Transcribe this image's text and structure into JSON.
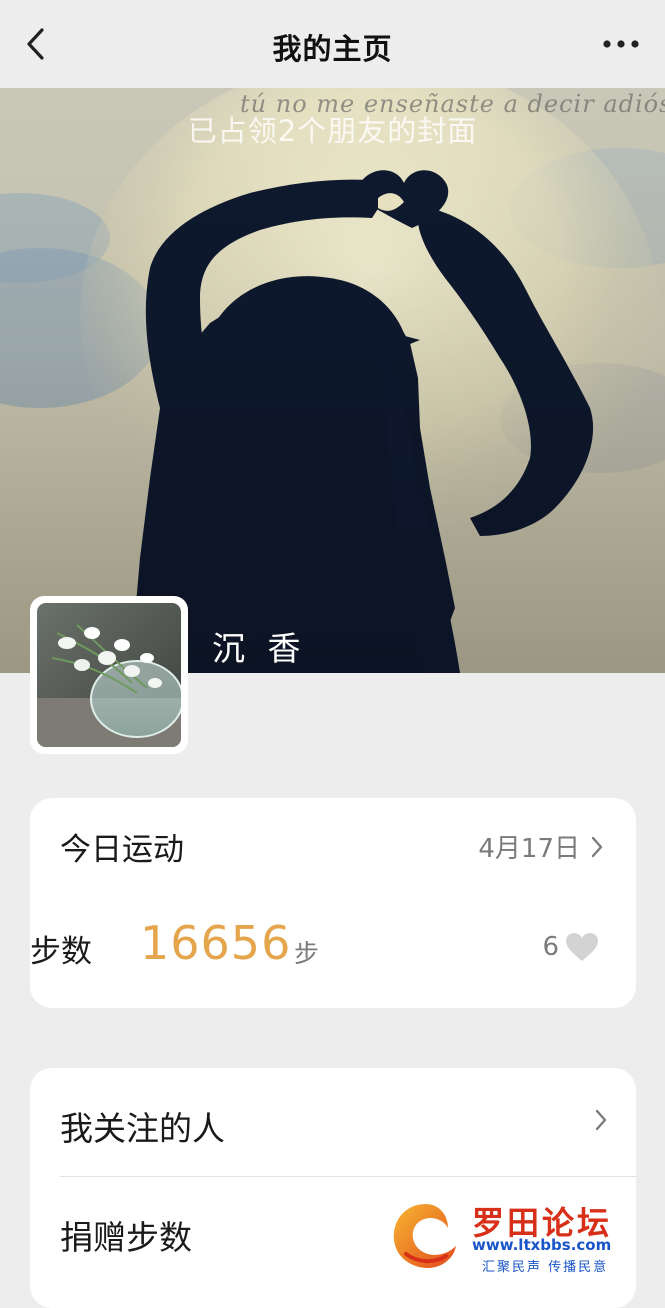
{
  "header": {
    "title": "我的主页"
  },
  "cover": {
    "caption": "已占领2个朋友的封面",
    "script_text": "tú no me enseñaste a decir adiós"
  },
  "profile": {
    "nickname": "沉 香"
  },
  "today_sport": {
    "title": "今日运动",
    "date": "4月17日",
    "steps_label": "步数",
    "steps_value": "16656",
    "steps_unit": "步",
    "likes": "6"
  },
  "menu": {
    "items": [
      {
        "label": "我关注的人"
      },
      {
        "label": "捐赠步数"
      }
    ]
  },
  "watermark": {
    "title": "罗田论坛",
    "url": "www.ltxbbs.com",
    "slogan": "汇聚民声 传播民意"
  },
  "colors": {
    "accent": "#e5a54c",
    "background": "#ededed",
    "card": "#ffffff"
  }
}
